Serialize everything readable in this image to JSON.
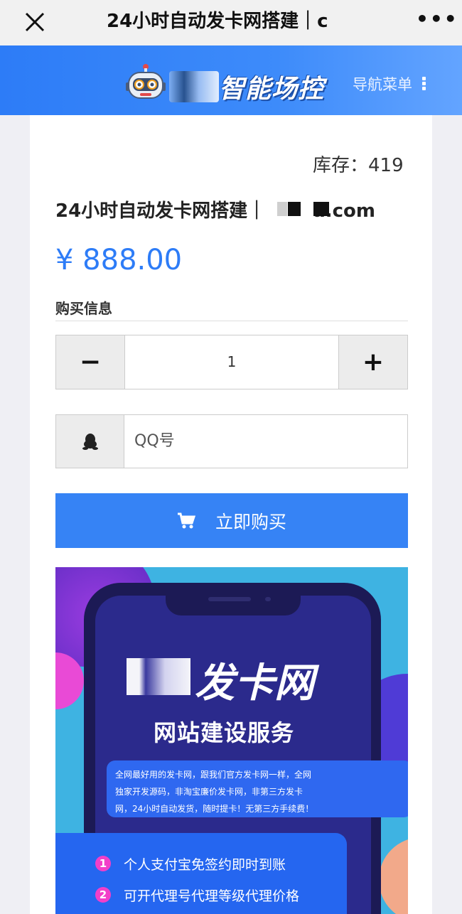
{
  "browser": {
    "title": "24小时自动发卡网搭建｜c",
    "more_icon": "more-dots-icon",
    "close_icon": "close-icon"
  },
  "header": {
    "logo_text": "智能场控",
    "nav_label": "导航菜单",
    "brand_color": "#2d7cf7"
  },
  "product": {
    "stock": "库存：419",
    "title_prefix": "24小时自动发卡网搭建｜",
    "title_suffix": "a.com",
    "price": "¥ 888.00"
  },
  "form": {
    "section_label": "购买信息",
    "quantity": "1",
    "minus_label": "−",
    "plus_label": "+",
    "qq_placeholder": "QQ号",
    "buy_label": "立即购买"
  },
  "banner": {
    "title": "发卡网",
    "subtitle": "网站建设服务",
    "description": [
      "全网最好用的发卡网，跟我们官方发卡网一样，全网",
      "独家开发源码，非淘宝廉价发卡网，非第三方发卡",
      "网，24小时自动发货，随时提卡！无第三方手续费！"
    ],
    "features": [
      {
        "num": "1",
        "text": "个人支付宝免签约即时到账"
      },
      {
        "num": "2",
        "text": "可开代理号代理等级代理价格"
      }
    ]
  }
}
